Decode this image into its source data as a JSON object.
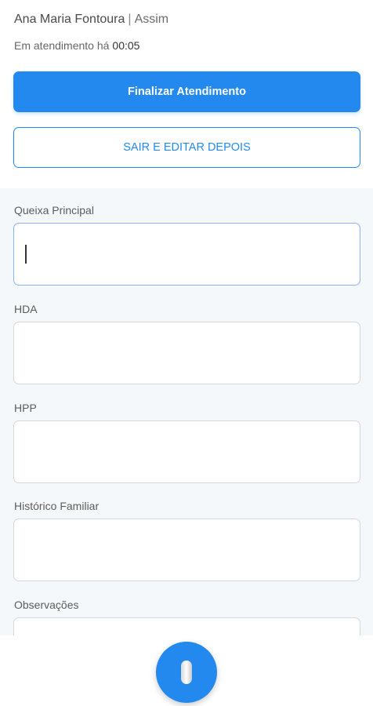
{
  "header": {
    "patient_name": "Ana Maria Fontoura",
    "separator": "|",
    "organization": "Assim",
    "timer_label": "Em atendimento há",
    "timer_value": "00:05"
  },
  "actions": {
    "finish_label": "Finalizar Atendimento",
    "exit_label": "SAIR E EDITAR DEPOIS"
  },
  "form": {
    "fields": [
      {
        "label": "Queixa Principal",
        "value": "",
        "focused": true
      },
      {
        "label": "HDA",
        "value": ""
      },
      {
        "label": "HPP",
        "value": ""
      },
      {
        "label": "Histórico Familiar",
        "value": ""
      },
      {
        "label": "Observações",
        "value": ""
      }
    ]
  },
  "icons": {
    "mic": "microphone-icon"
  },
  "colors": {
    "primary": "#2489ee",
    "form_background": "#f5f8fb",
    "field_border": "#d4d8dd",
    "focus_border": "#8ab4f8"
  }
}
